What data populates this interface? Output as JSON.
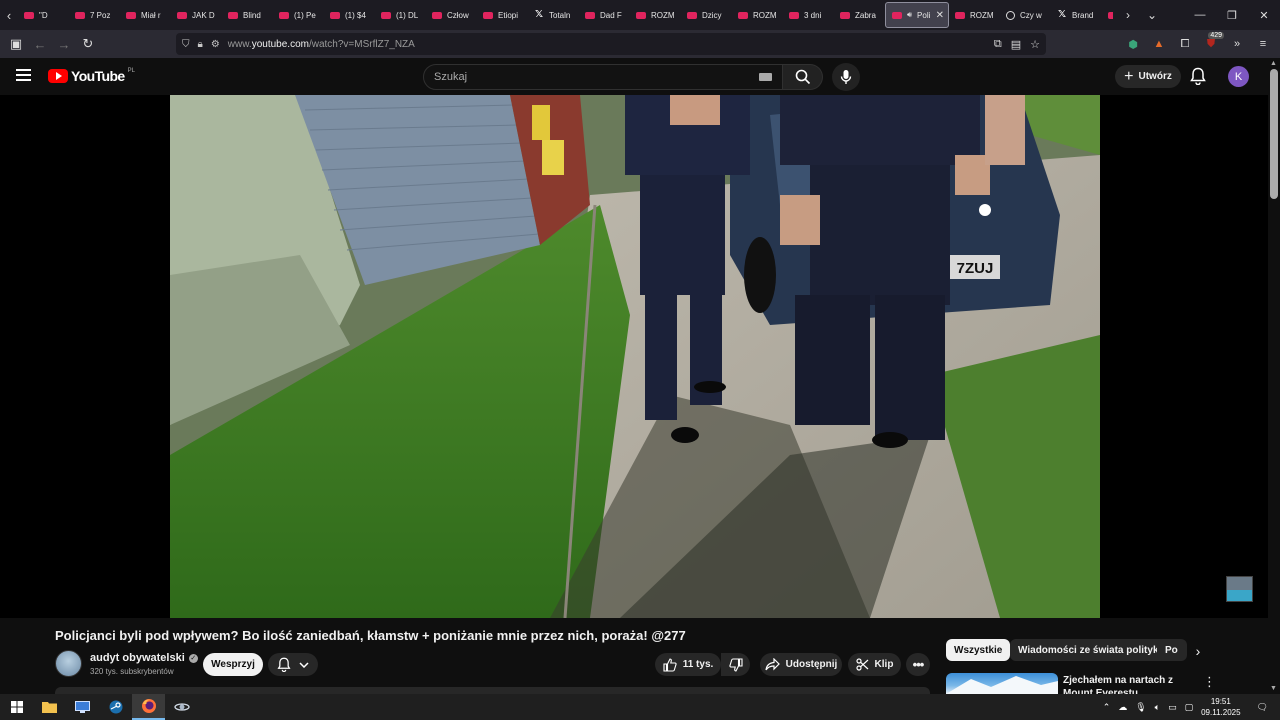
{
  "browser": {
    "tabs": [
      {
        "label": "\"D",
        "icon": "youtube-icon"
      },
      {
        "label": "7 Poz",
        "icon": "youtube-icon"
      },
      {
        "label": "Miał r",
        "icon": "youtube-icon"
      },
      {
        "label": "JAK D",
        "icon": "youtube-icon"
      },
      {
        "label": "Blind",
        "icon": "youtube-icon"
      },
      {
        "label": "(1) Pe",
        "icon": "youtube-icon"
      },
      {
        "label": "(1) $4",
        "icon": "youtube-icon"
      },
      {
        "label": "(1) DL",
        "icon": "youtube-icon"
      },
      {
        "label": "Człow",
        "icon": "youtube-icon"
      },
      {
        "label": "Etiopi",
        "icon": "youtube-icon"
      },
      {
        "label": "Totaln",
        "icon": "x-icon"
      },
      {
        "label": "Dad F",
        "icon": "youtube-icon"
      },
      {
        "label": "ROZM",
        "icon": "youtube-icon"
      },
      {
        "label": "Dzicy",
        "icon": "youtube-icon"
      },
      {
        "label": "ROZM",
        "icon": "youtube-icon"
      },
      {
        "label": "3 dni",
        "icon": "youtube-icon"
      },
      {
        "label": "Zabra",
        "icon": "youtube-icon"
      },
      {
        "label": "Poli",
        "icon": "youtube-icon",
        "active": true
      },
      {
        "label": "ROZM",
        "icon": "youtube-icon"
      },
      {
        "label": "Czy w",
        "icon": "circle-icon"
      },
      {
        "label": "Brand",
        "icon": "x-icon"
      },
      {
        "label": "",
        "icon": "youtube-icon"
      }
    ],
    "url_prefix": "www.",
    "url_domain": "youtube.com",
    "url_path": "/watch?v=MSrflZ7_NZA",
    "extension_badge": "429"
  },
  "youtube": {
    "logo_text": "YouTube",
    "country_code": "PL",
    "search_placeholder": "Szukaj",
    "create_label": "Utwórz",
    "avatar_letter": "K"
  },
  "video": {
    "title": "Policjanci byli pod wpływem? Bo ilość zaniedbań, kłamstw + poniżanie mnie przez nich, poraża! @277",
    "channel_name": "audyt obywatelski",
    "subscribers": "320 tys. subskrybentów",
    "support_label": "Wesprzyj",
    "likes": "11 tys.",
    "share_label": "Udostępnij",
    "clip_label": "Klip",
    "plate_text": "7ZUJ",
    "sign_text": "L"
  },
  "sidebar": {
    "chips": [
      "Wszystkie",
      "Wiadomości ze świata polityki",
      "Po"
    ],
    "recommendation_title": "Zjechałem na nartach z Mount Everestu"
  },
  "taskbar": {
    "time": "19:51",
    "date": "09.11.2025"
  }
}
